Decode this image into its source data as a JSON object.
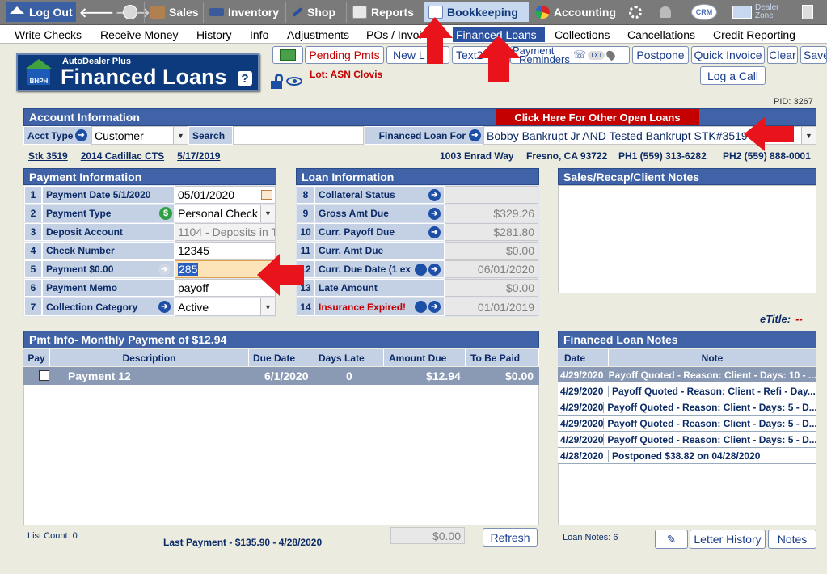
{
  "top_nav": {
    "logout": "Log Out",
    "sales": "Sales",
    "inventory": "Inventory",
    "shop": "Shop",
    "reports": "Reports",
    "bookkeeping": "Bookkeeping",
    "accounting": "Accounting",
    "crm": "CRM",
    "dealer_zone_1": "Dealer",
    "dealer_zone_2": "Zone"
  },
  "sub_nav": [
    "Write Checks",
    "Receive Money",
    "History",
    "Info",
    "Adjustments",
    "POs / Invoi",
    "Financed Loans",
    "Collections",
    "Cancellations",
    "Credit Reporting"
  ],
  "logo": {
    "brand": "AutoDealer Plus",
    "title": "Financed Loans",
    "badge": "BHPH",
    "help": "?"
  },
  "toolbar": {
    "pending": "Pending Pmts",
    "new_loan": "New L",
    "text": "Text2",
    "reminders_1": "Payment",
    "reminders_2": "Reminders",
    "txt": "TXT",
    "postpone": "Postpone",
    "quick_invoice": "Quick Invoice",
    "clear": "Clear",
    "save": "Save",
    "log_call": "Log a Call"
  },
  "lot": "Lot: ASN Clovis",
  "pid": "PID: 3267",
  "account": {
    "header": "Account Information",
    "other_loans": "Click Here For Other Open Loans",
    "acct_type_label": "Acct Type",
    "acct_type": "Customer",
    "search_label": "Search",
    "search_value": "",
    "loan_for_label": "Financed Loan For",
    "loan_for": "Bobby Bankrupt Jr AND Tested Bankrupt STK#3519"
  },
  "vehicle": {
    "stk": "Stk 3519",
    "car": "2014 Cadillac CTS",
    "date": "5/17/2019"
  },
  "contact": {
    "address": "1003 Enrad Way",
    "city": "Fresno, CA 93722",
    "ph1": "PH1 (559) 313-6282",
    "ph2": "PH2 (559) 888-0001"
  },
  "payment_info": {
    "header": "Payment Information",
    "rows": [
      {
        "n": "1",
        "label": "Payment Date  5/1/2020",
        "value": "05/01/2020"
      },
      {
        "n": "2",
        "label": "Payment Type",
        "value": "Personal Check"
      },
      {
        "n": "3",
        "label": "Deposit Account",
        "value": "1104 - Deposits in T"
      },
      {
        "n": "4",
        "label": "Check Number",
        "value": "12345"
      },
      {
        "n": "5",
        "label": "Payment  $0.00",
        "value": "285"
      },
      {
        "n": "6",
        "label": "Payment Memo",
        "value": "payoff"
      },
      {
        "n": "7",
        "label": "Collection Category",
        "value": "Active"
      }
    ]
  },
  "loan_info": {
    "header": "Loan Information",
    "rows": [
      {
        "n": "8",
        "label": "Collateral Status",
        "value": ""
      },
      {
        "n": "9",
        "label": "Gross Amt Due",
        "value": "$329.26"
      },
      {
        "n": "10",
        "label": "Curr. Payoff Due",
        "value": "$281.80"
      },
      {
        "n": "11",
        "label": "Curr. Amt Due",
        "value": "$0.00"
      },
      {
        "n": "12",
        "label": "Curr. Due Date (1 ex",
        "value": "06/01/2020"
      },
      {
        "n": "13",
        "label": "Late Amount",
        "value": "$0.00"
      },
      {
        "n": "14",
        "label": "Insurance Expired!",
        "value": "01/01/2019"
      }
    ]
  },
  "notes_panel": {
    "header": "Sales/Recap/Client Notes"
  },
  "etitle": {
    "label": "eTitle:",
    "value": "--"
  },
  "pmt_table": {
    "header": "Pmt Info- Monthly Payment of $12.94",
    "columns": [
      "Pay",
      "Description",
      "Due Date",
      "Days Late",
      "Amount Due",
      "To Be Paid"
    ],
    "rows": [
      {
        "desc": "Payment 12",
        "due": "6/1/2020",
        "late": "0",
        "amount": "$12.94",
        "paid": "$0.00"
      }
    ],
    "list_count": "List Count:  0",
    "last_payment": "Last Payment - $135.90 - 4/28/2020",
    "total": "$0.00",
    "refresh": "Refresh"
  },
  "loan_notes": {
    "header": "Financed Loan Notes",
    "columns": [
      "Date",
      "Note"
    ],
    "rows": [
      {
        "date": "4/29/2020",
        "note": "Payoff Quoted - Reason: Client - Days: 10 - ..."
      },
      {
        "date": "4/29/2020",
        "note": "Payoff Quoted - Reason: Client - Refi - Day..."
      },
      {
        "date": "4/29/2020",
        "note": "Payoff Quoted - Reason: Client - Days: 5 - D..."
      },
      {
        "date": "4/29/2020",
        "note": "Payoff Quoted - Reason: Client - Days: 5 - D..."
      },
      {
        "date": "4/29/2020",
        "note": "Payoff Quoted - Reason: Client - Days: 5 - D..."
      },
      {
        "date": "4/28/2020",
        "note": "Postponed $38.82 on 04/28/2020"
      }
    ],
    "count": "Loan Notes:  6",
    "letter_history": "Letter History",
    "notes": "Notes"
  },
  "colors": {
    "accent": "#3f63a6",
    "header_dark": "#0c3a7c",
    "red": "#c40000",
    "arrow": "#e8131b"
  }
}
